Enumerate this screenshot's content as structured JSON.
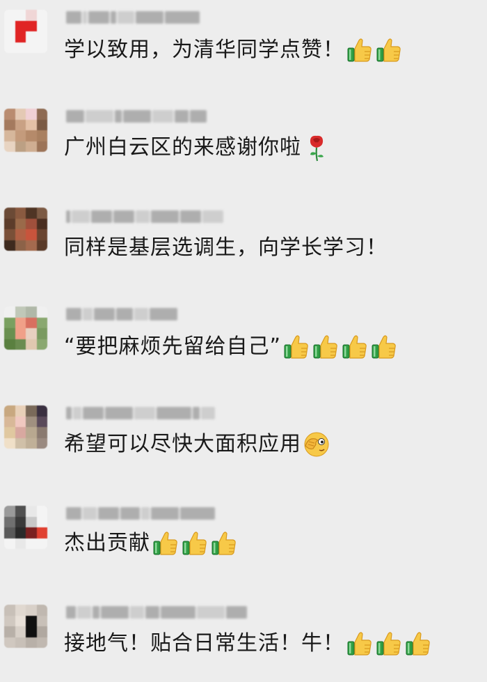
{
  "comments": [
    {
      "text": "学以致用，为清华同学点赞！",
      "emoji": [
        "thumbs-up",
        "thumbs-up"
      ]
    },
    {
      "text": "广州白云区的来感谢你啦",
      "emoji": [
        "rose"
      ]
    },
    {
      "text": "同样是基层选调生，向学长学习！",
      "emoji": []
    },
    {
      "text": "“要把麻烦先留给自己”",
      "emoji": [
        "thumbs-up",
        "thumbs-up",
        "thumbs-up",
        "thumbs-up"
      ]
    },
    {
      "text": "希望可以尽快大面积应用",
      "emoji": [
        "facepalm"
      ]
    },
    {
      "text": "杰出贡献",
      "emoji": [
        "thumbs-up",
        "thumbs-up",
        "thumbs-up"
      ]
    },
    {
      "text": "接地气！贴合日常生活！牛！",
      "emoji": [
        "thumbs-up",
        "thumbs-up",
        "thumbs-up"
      ]
    }
  ],
  "colors": {
    "background": "#ededed",
    "text": "#191919",
    "name_blur": "#9a9a9a"
  }
}
